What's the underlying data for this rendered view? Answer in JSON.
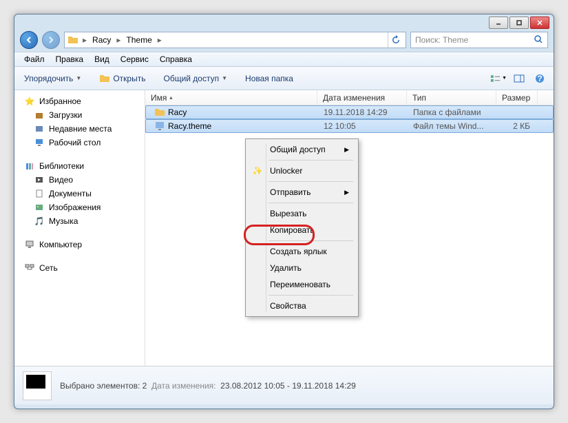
{
  "breadcrumb": {
    "crumb1": "Racy",
    "crumb2": "Theme"
  },
  "search": {
    "placeholder": "Поиск: Theme"
  },
  "menubar": {
    "file": "Файл",
    "edit": "Правка",
    "view": "Вид",
    "service": "Сервис",
    "help": "Справка"
  },
  "toolbar": {
    "organize": "Упорядочить",
    "open": "Открыть",
    "share": "Общий доступ",
    "newfolder": "Новая папка"
  },
  "columns": {
    "name": "Имя",
    "date": "Дата изменения",
    "type": "Тип",
    "size": "Размер"
  },
  "files": {
    "row0": {
      "name": "Racy",
      "date": "19.11.2018 14:29",
      "type": "Папка с файлами",
      "size": ""
    },
    "row1": {
      "name": "Racy.theme",
      "date": "12 10:05",
      "type": "Файл темы Wind...",
      "size": "2 КБ"
    }
  },
  "sidebar": {
    "favorites": "Избранное",
    "downloads": "Загрузки",
    "recent": "Недавние места",
    "desktop": "Рабочий стол",
    "libraries": "Библиотеки",
    "video": "Видео",
    "documents": "Документы",
    "pictures": "Изображения",
    "music": "Музыка",
    "computer": "Компьютер",
    "network": "Сеть"
  },
  "context": {
    "share": "Общий доступ",
    "unlocker": "Unlocker",
    "send": "Отправить",
    "cut": "Вырезать",
    "copy": "Копировать",
    "shortcut": "Создать ярлык",
    "delete": "Удалить",
    "rename": "Переименовать",
    "props": "Свойства"
  },
  "status": {
    "selected": "Выбрано элементов: 2",
    "datelabel": "Дата изменения:",
    "dates": "23.08.2012 10:05 - 19.11.2018 14:29"
  }
}
